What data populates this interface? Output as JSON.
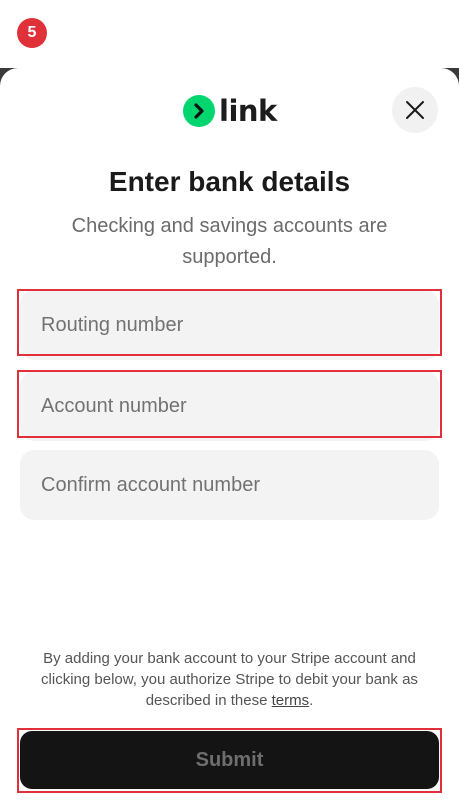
{
  "step_badge": "5",
  "logo": {
    "word": "link",
    "brand_color": "#00d66f"
  },
  "close_icon": "close-icon",
  "title": "Enter bank details",
  "subtitle": "Checking and savings accounts are supported.",
  "fields": {
    "routing": {
      "placeholder": "Routing number",
      "value": ""
    },
    "account": {
      "placeholder": "Account number",
      "value": ""
    },
    "confirm": {
      "placeholder": "Confirm account number",
      "value": ""
    }
  },
  "legal": {
    "text": "By adding your bank account to your Stripe account and clicking below, you authorize Stripe to debit your bank as described in these",
    "link": "terms",
    "end": "."
  },
  "submit_label": "Submit",
  "colors": {
    "highlight": "#e0313b",
    "button_bg": "#141414",
    "field_bg": "#f3f3f3"
  }
}
